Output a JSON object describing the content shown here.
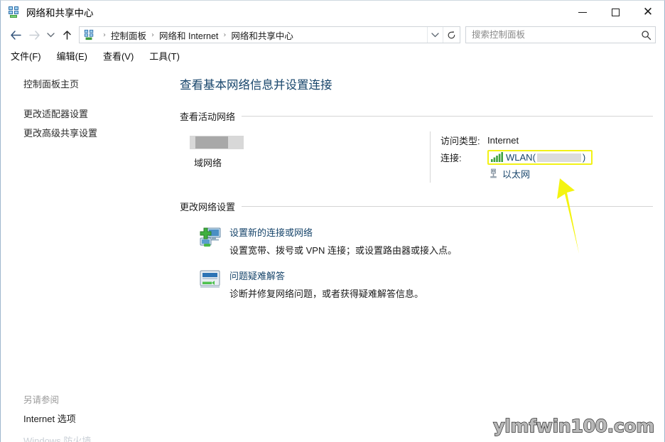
{
  "window": {
    "title": "网络和共享中心",
    "title_icon": "network-sharing-icon",
    "controls": {
      "minimize": "minimize-icon",
      "maximize": "maximize-icon",
      "close": "close-icon"
    }
  },
  "addressbar": {
    "back": "back-arrow-icon",
    "forward": "forward-arrow-icon",
    "recent": "chevron-down-icon",
    "up": "up-arrow-icon",
    "crumb_icon": "control-panel-icon",
    "crumbs": [
      "控制面板",
      "网络和 Internet",
      "网络和共享中心"
    ],
    "separator": "›",
    "dropdown": "chevron-down-icon",
    "refresh": "refresh-icon"
  },
  "search": {
    "placeholder": "搜索控制面板",
    "value": "",
    "icon": "search-icon"
  },
  "menubar": {
    "items": [
      "文件(F)",
      "编辑(E)",
      "查看(V)",
      "工具(T)"
    ]
  },
  "sidebar": {
    "home": "控制面板主页",
    "links": [
      "更改适配器设置",
      "更改高级共享设置"
    ],
    "see_also": {
      "title": "另请参阅",
      "items": [
        "Internet 选项",
        "Windows 防火墙"
      ]
    }
  },
  "main": {
    "page_title": "查看基本网络信息并设置连接",
    "active_section": {
      "heading": "查看活动网络",
      "network_name_redacted": true,
      "network_type": "域网络",
      "access_type_label": "访问类型:",
      "access_type_value": "Internet",
      "connections_label": "连接:",
      "wlan_label": "WLAN",
      "wlan_paren_open": "(",
      "wlan_paren_close": ")",
      "wlan_ssid_redacted": true,
      "wlan_icon": "wifi-signal-icon",
      "ethernet_label": "以太网",
      "ethernet_icon": "ethernet-plug-icon",
      "highlight_color": "#f2f216"
    },
    "change_section": {
      "heading": "更改网络设置",
      "options": [
        {
          "icon": "new-connection-icon",
          "title": "设置新的连接或网络",
          "desc": "设置宽带、拨号或 VPN 连接；或设置路由器或接入点。"
        },
        {
          "icon": "troubleshoot-icon",
          "title": "问题疑难解答",
          "desc": "诊断并修复网络问题，或者获得疑难解答信息。"
        }
      ]
    }
  },
  "annotation": {
    "arrow": "yellow-arrow-up",
    "arrow_color": "#f2f216"
  },
  "watermark": {
    "text": "ylmfwin100.com"
  }
}
